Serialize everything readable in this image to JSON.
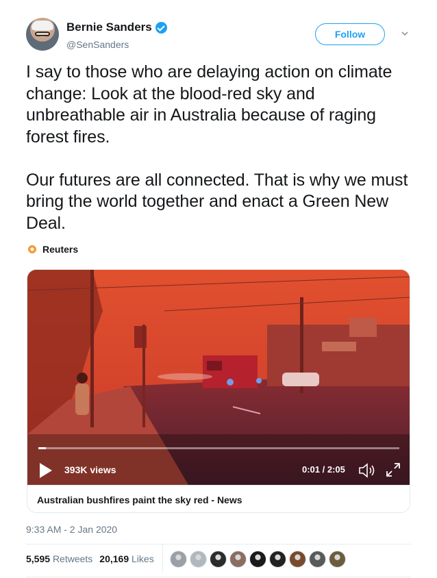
{
  "author": {
    "display_name": "Bernie Sanders",
    "handle": "@SenSanders",
    "avatar_icon": "avatar-photo",
    "verified_icon": "verified-badge-icon"
  },
  "actions": {
    "follow_label": "Follow",
    "more_icon": "chevron-down-icon"
  },
  "tweet": {
    "paragraph1": "I say to those who are delaying action on climate change: Look at the blood-red sky and unbreathable air in Australia because of raging forest fires.",
    "paragraph2": "Our futures are all connected. That is why we must bring the world together and enact a Green New Deal."
  },
  "source": {
    "label": "Reuters",
    "icon": "reuters-logo-icon"
  },
  "video": {
    "views": "393K views",
    "time": "0:01 / 2:05",
    "progress": 0.01,
    "caption": "Australian bushfires paint the sky red - News",
    "play_icon": "play-icon",
    "volume_icon": "volume-icon",
    "fullscreen_icon": "expand-icon"
  },
  "meta": {
    "timestamp": "9:33 AM - 2 Jan 2020"
  },
  "stats": {
    "retweets_count": "5,595",
    "retweets_label": "Retweets",
    "likes_count": "20,169",
    "likes_label": "Likes"
  },
  "liker_colors": [
    "#9aa0a6",
    "#b0b7bf",
    "#2c2c2c",
    "#8c6d62",
    "#1a1a1a",
    "#222222",
    "#7a4a2e",
    "#5a5a5a",
    "#6b5d3e"
  ],
  "colors": {
    "accent": "#1da1f2",
    "muted": "#657786",
    "sky": "#d9482f"
  }
}
